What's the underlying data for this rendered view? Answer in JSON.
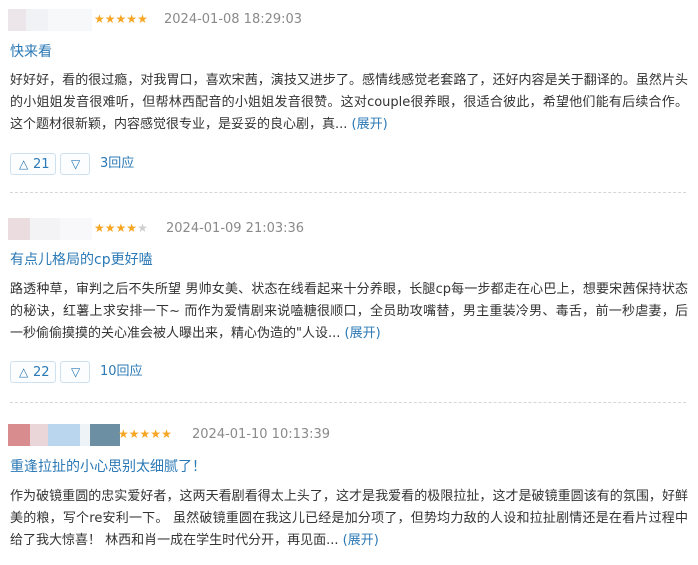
{
  "reviews": [
    {
      "rating": 5,
      "time": "2024-01-08 18:29:03",
      "title": "快来看",
      "text": "好好好，看的很过瘾，对我胃口，喜欢宋茜，演技又进步了。感情线感觉老套路了，还好内容是关于翻译的。虽然片头的小姐姐发音很难听，但帮林西配音的小姐姐发音很赞。这对couple很养眼，很适合彼此，希望他们能有后续合作。这个题材很新颖，内容感觉很专业，是妥妥的良心剧，真...",
      "expand_label": "(展开)",
      "likes": "21",
      "replies": "3回应"
    },
    {
      "rating": 4,
      "time": "2024-01-09 21:03:36",
      "title": "有点儿格局的cp更好嗑",
      "text": "路透种草，审判之后不失所望 男帅女美、状态在线看起来十分养眼，长腿cp每一步都走在心巴上，想要宋茜保持状态的秘诀，红薯上求安排一下~ 而作为爱情剧来说嗑糖很顺口，全员助攻嘴替，男主重装冷男、毒舌，前一秒虐妻，后一秒偷偷摸摸的关心准会被人曝出来，精心伪造的\"人设...",
      "expand_label": "(展开)",
      "likes": "22",
      "replies": "10回应"
    },
    {
      "rating": 5,
      "time": "2024-01-10 10:13:39",
      "title": "重逢拉扯的小心思别太细腻了！",
      "text": "作为破镜重圆的忠实爱好者，这两天看剧看得太上头了，这才是我爱看的极限拉扯，这才是破镜重圆该有的氛围，好鲜美的粮，写个re安利一下。 虽然破镜重圆在我这儿已经是加分项了，但势均力敌的人设和拉扯剧情还是在看片过程中给了我大惊喜！ 林西和肖一成在学生时代分开，再见面...",
      "expand_label": "(展开)"
    }
  ],
  "icons": {
    "up": "triangle-up-icon",
    "down": "triangle-down-icon",
    "star": "star-icon"
  },
  "colors": {
    "link": "#2b79b5",
    "star": "#f6a623",
    "star_off": "#cfcfcf"
  }
}
